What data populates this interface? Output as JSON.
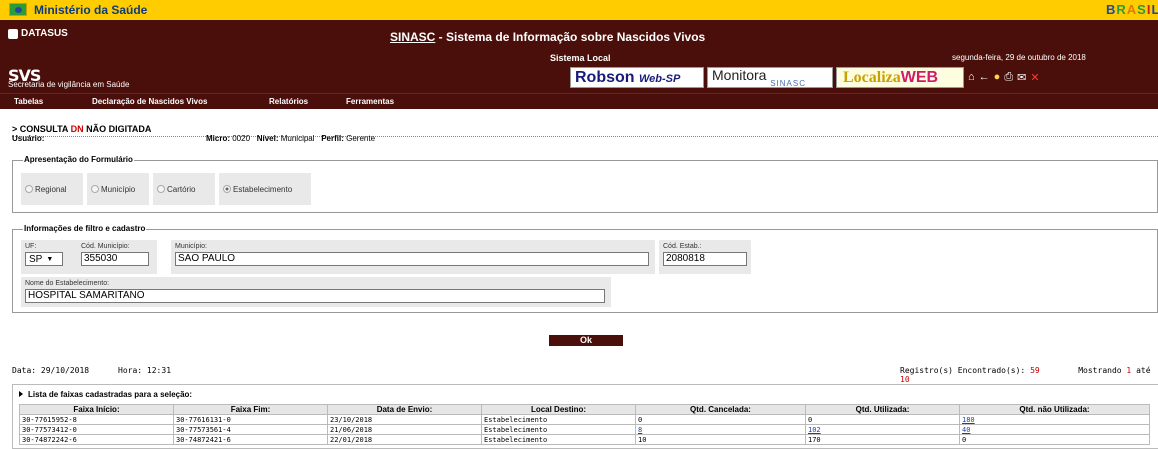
{
  "gov": {
    "title": "Ministério da Saúde",
    "logo_text": [
      "B",
      "R",
      "A",
      "S",
      "I",
      "L"
    ]
  },
  "header": {
    "datasus": "DATASUS",
    "app_acronym": "SINASC",
    "app_title_rest": " - Sistema de Informação sobre Nascidos Vivos",
    "sublocal": "Sistema Local",
    "date": "segunda-feira, 29 de outubro de 2018",
    "svs": "SVS",
    "svs_full": "Secretaria de vigilância em Saúde",
    "banners": {
      "robson": "Robson",
      "robson_sub": "Web-SP",
      "monitora": "Monitora",
      "monitora_sub": "SINASC",
      "localiza": "Localiza",
      "localiza_sub": "WEB"
    },
    "tool_icons": [
      "home-icon",
      "back-arrow-icon",
      "lightbulb-icon",
      "print-icon",
      "mail-icon",
      "close-icon"
    ]
  },
  "menu": [
    "Tabelas",
    "Declaração de Nascidos Vivos",
    "Relatórios",
    "Ferramentas"
  ],
  "page": {
    "crumb_prefix": "> CONSULTA ",
    "crumb_dn": "DN",
    "crumb_suffix": " NÃO DIGITADA",
    "user_label": "Usuário:",
    "micro_label": "Micro:",
    "micro_value": "0020",
    "nivel_label": "Nível:",
    "nivel_value": "Municipal",
    "perfil_label": "Perfil:",
    "perfil_value": "Gerente"
  },
  "form": {
    "legend": "Apresentação do Formulário",
    "options": [
      {
        "label": "Regional",
        "checked": false
      },
      {
        "label": "Município",
        "checked": false
      },
      {
        "label": "Cartório",
        "checked": false
      },
      {
        "label": "Estabelecimento",
        "checked": true
      }
    ]
  },
  "filter": {
    "legend": "Informações de filtro e cadastro",
    "uf_label": "UF:",
    "uf_value": "SP",
    "cod_municipio_label": "Cód. Município:",
    "cod_municipio_value": "355030",
    "municipio_label": "Município:",
    "municipio_value": "SAO PAULO",
    "cod_estab_label": "Cód. Estab.:",
    "cod_estab_value": "2080818",
    "nome_estab_label": "Nome do Estabelecimento:",
    "nome_estab_value": "HOSPITAL SAMARITANO"
  },
  "ok_label": "Ok",
  "status": {
    "data_label": "Data:",
    "data_value": "29/10/2018",
    "hora_label": "Hora:",
    "hora_value": "12:31",
    "registros_label": "Registro(s) Encontrado(s):",
    "registros_value": "59",
    "mostrando_label": "Mostrando",
    "mostrando_from": "1",
    "ate_label": "até",
    "mostrando_to": "10"
  },
  "list": {
    "title": "Lista de faixas cadastradas para a seleção:",
    "columns": [
      "Faixa Início:",
      "Faixa Fim:",
      "Data de Envio:",
      "Local Destino:",
      "Qtd. Cancelada:",
      "Qtd. Utilizada:",
      "Qtd. não Utilizada:"
    ],
    "rows": [
      [
        "30-77615952-8",
        "30-77616131-0",
        "23/10/2018",
        "Estabelecimento",
        "0",
        "0",
        "180"
      ],
      [
        "30-77573412-0",
        "30-77573561-4",
        "21/06/2018",
        "Estabelecimento",
        "8",
        "102",
        "40"
      ],
      [
        "30-74872242-6",
        "30-74872421-6",
        "22/01/2018",
        "Estabelecimento",
        "10",
        "170",
        "0"
      ]
    ],
    "links": [
      [
        false,
        false,
        false,
        false,
        false,
        false,
        true
      ],
      [
        false,
        false,
        false,
        false,
        true,
        true,
        true
      ],
      [
        false,
        false,
        false,
        false,
        false,
        false,
        false
      ]
    ]
  }
}
